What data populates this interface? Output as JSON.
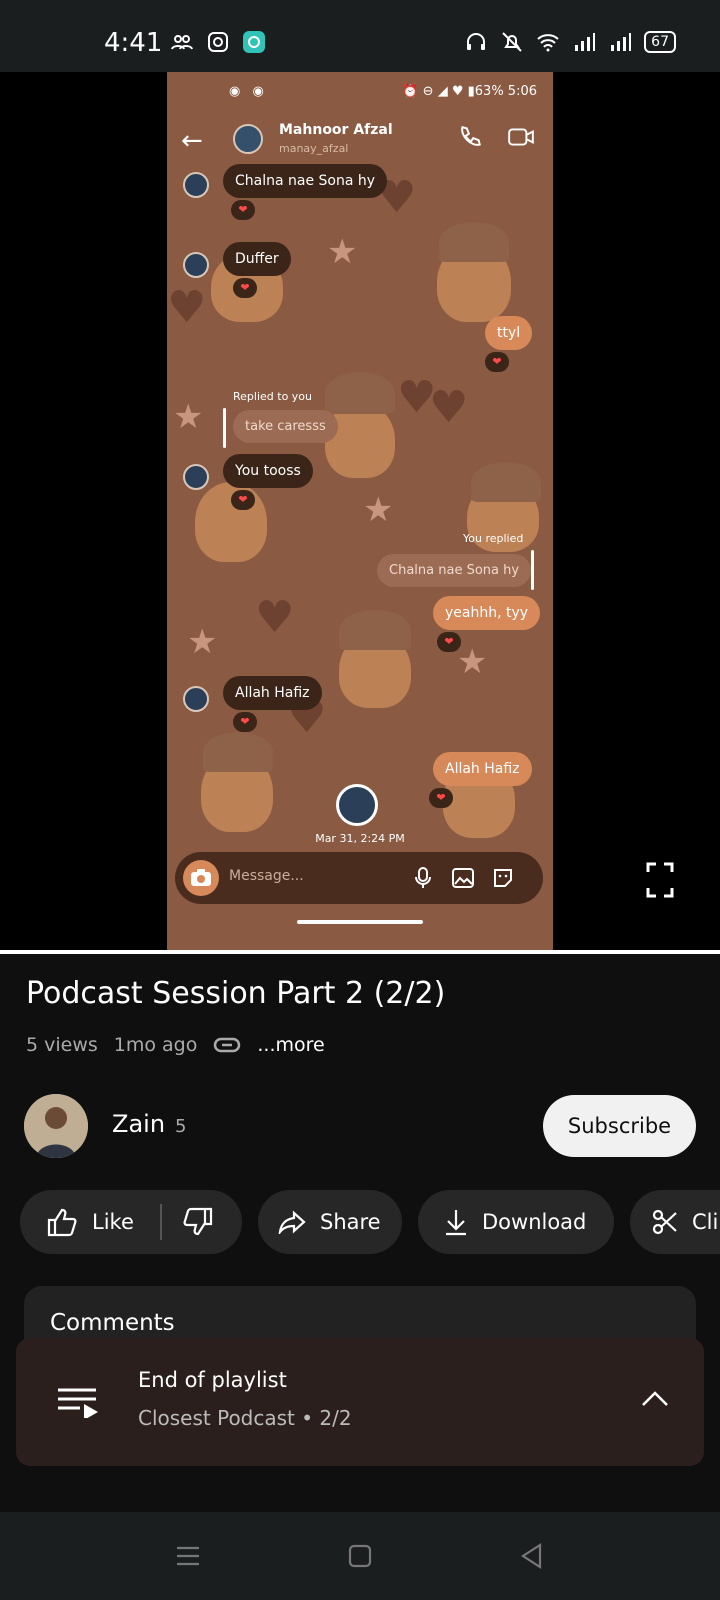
{
  "status_bar": {
    "time": "4:41",
    "battery": "67"
  },
  "video": {
    "phone_status": {
      "left_icons": "◉ ◉",
      "right_text": "⏰ ⊖ ◢ ♥ ▮63% 5:06"
    },
    "contact": {
      "name": "Mahnoor Afzal",
      "username": "manay_afzal"
    },
    "messages": [
      {
        "text": "Chalna nae Sona hy",
        "dir": "in"
      },
      {
        "text": "Duffer",
        "dir": "in"
      },
      {
        "text": "ttyl",
        "dir": "out"
      },
      {
        "text": "take caresss",
        "dir": "quoted-in"
      },
      {
        "text": "You tooss",
        "dir": "in"
      },
      {
        "text": "Chalna nae Sona hy",
        "dir": "quoted-out"
      },
      {
        "text": "yeahhh, tyy",
        "dir": "out"
      },
      {
        "text": "Allah Hafiz",
        "dir": "in"
      },
      {
        "text": "Allah Hafiz",
        "dir": "out"
      }
    ],
    "replied_to_you": "Replied to you",
    "you_replied": "You replied",
    "reaction": "❤",
    "timestamp": "Mar 31, 2:24 PM",
    "composer_placeholder": "Message..."
  },
  "details": {
    "title": "Podcast Session Part 2 (2/2)",
    "views": "5 views",
    "age": "1mo ago",
    "more": "...more",
    "channel_name": "Zain",
    "channel_subs": "5",
    "subscribe": "Subscribe",
    "actions": {
      "like": "Like",
      "share": "Share",
      "download": "Download",
      "clip": "Cli"
    },
    "comments_header": "Comments"
  },
  "playlist_bar": {
    "title": "End of playlist",
    "subtitle": "Closest Podcast • 2/2"
  },
  "colors": {
    "accent": "#f1f1f1",
    "chat_bg": "#8a5a42",
    "bubble_out": "#d8895a",
    "bubble_in": "#3b2418"
  }
}
